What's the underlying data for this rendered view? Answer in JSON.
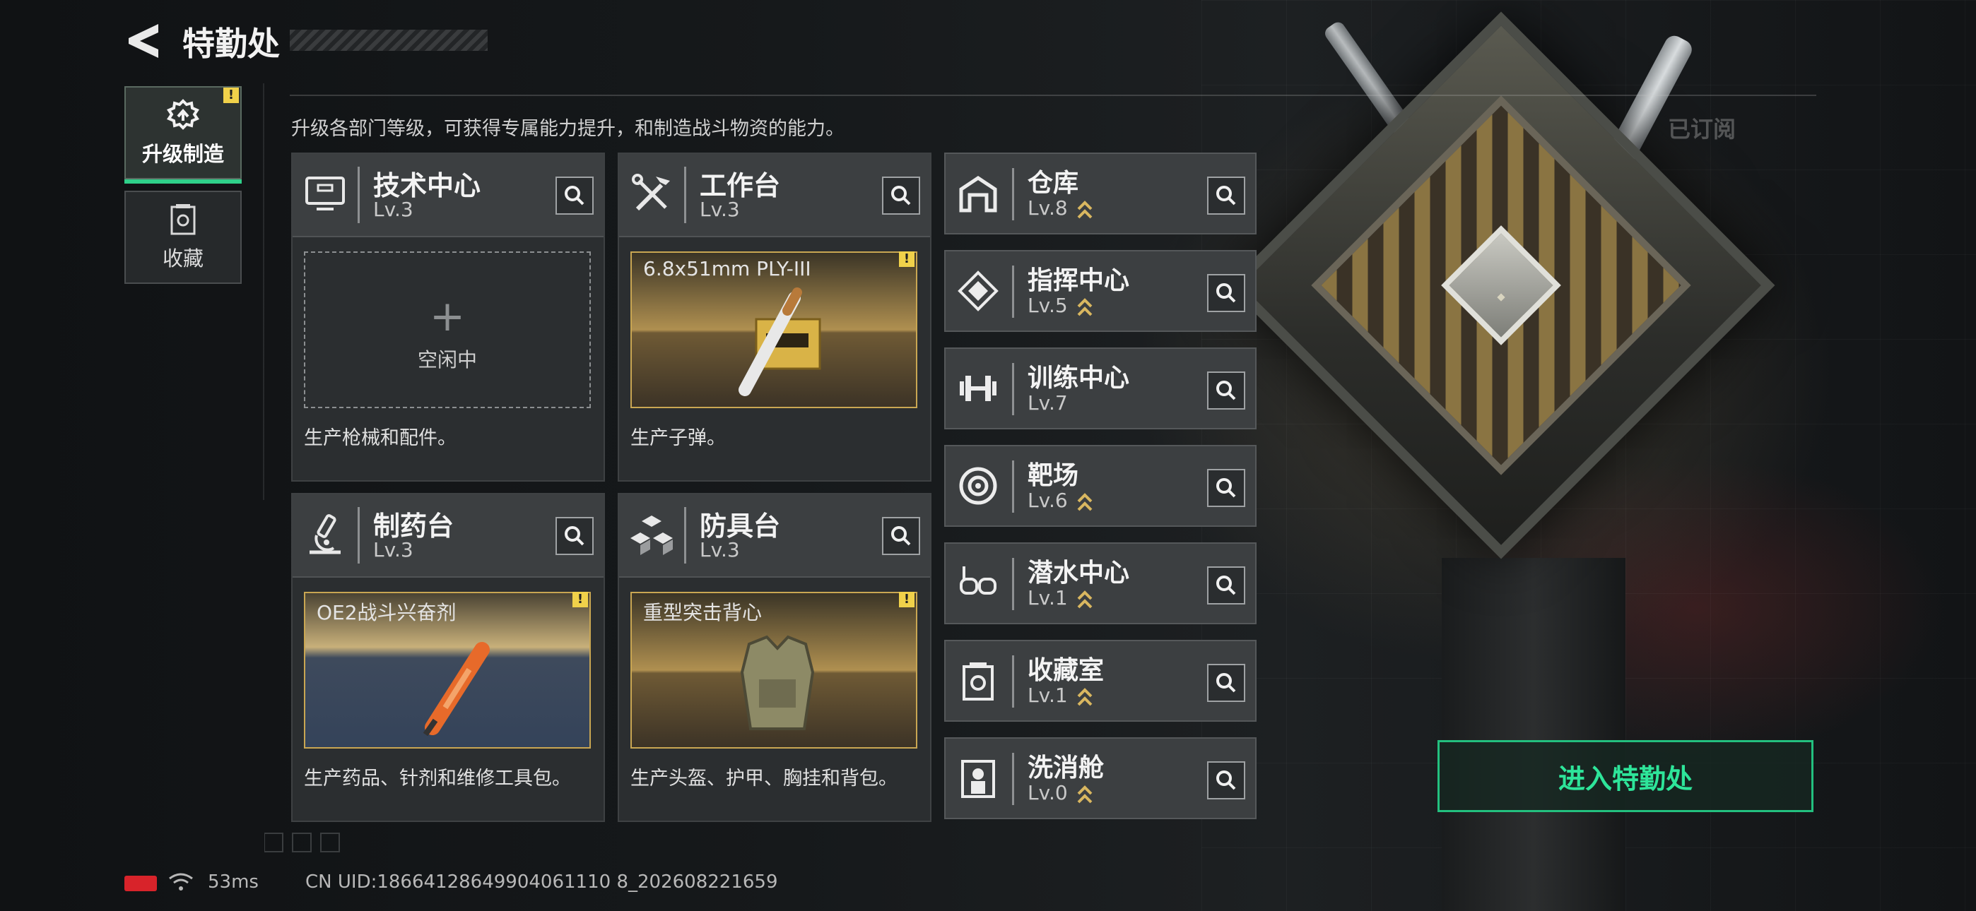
{
  "header": {
    "title": "特勤处",
    "subtitle": "升级各部门等级，可获得专属能力提升，和制造战斗物资的能力。",
    "subscribe_label": "已订阅"
  },
  "nav": {
    "items": [
      {
        "label": "升级制造",
        "active": true,
        "warning": "!"
      },
      {
        "label": "收藏",
        "active": false
      }
    ]
  },
  "cards": [
    {
      "name": "技术中心",
      "level": "Lv.3",
      "icon": "monitor-icon",
      "slot_state": "empty",
      "plus": "+",
      "idle_label": "空闲中",
      "description": "生产枪械和配件。"
    },
    {
      "name": "工作台",
      "level": "Lv.3",
      "icon": "tools-icon",
      "slot_state": "producing",
      "item_name": "6.8x51mm PLY-III",
      "warning": "!",
      "description": "生产子弹。"
    },
    {
      "name": "制药台",
      "level": "Lv.3",
      "icon": "microscope-icon",
      "slot_state": "producing",
      "item_name": "OE2战斗兴奋剂",
      "warning": "!",
      "description": "生产药品、针剂和维修工具包。"
    },
    {
      "name": "防具台",
      "level": "Lv.3",
      "icon": "armor-blocks-icon",
      "slot_state": "producing",
      "item_name": "重型突击背心",
      "warning": "!",
      "description": "生产头盔、护甲、胸挂和背包。"
    }
  ],
  "facilities": [
    {
      "name": "仓库",
      "level": "Lv.8",
      "icon": "warehouse-icon",
      "upgradable": true
    },
    {
      "name": "指挥中心",
      "level": "Lv.5",
      "icon": "command-icon",
      "upgradable": true
    },
    {
      "name": "训练中心",
      "level": "Lv.7",
      "icon": "dumbbell-icon",
      "upgradable": false
    },
    {
      "name": "靶场",
      "level": "Lv.6",
      "icon": "target-icon",
      "upgradable": true
    },
    {
      "name": "潜水中心",
      "level": "Lv.1",
      "icon": "diving-mask-icon",
      "upgradable": true
    },
    {
      "name": "收藏室",
      "level": "Lv.1",
      "icon": "collection-icon",
      "upgradable": true
    },
    {
      "name": "洗消舱",
      "level": "Lv.0",
      "icon": "decon-icon",
      "upgradable": true
    }
  ],
  "enter_button": {
    "label": "进入特勤处"
  },
  "status": {
    "ping": "53ms",
    "uid": "CN UID:18664128649904061110 8_202608221659"
  },
  "colors": {
    "accent_green": "#2ee59a",
    "warning_yellow": "#f0d14a",
    "upgrade_gold": "#d9b760",
    "battery_red": "#d8232a"
  }
}
